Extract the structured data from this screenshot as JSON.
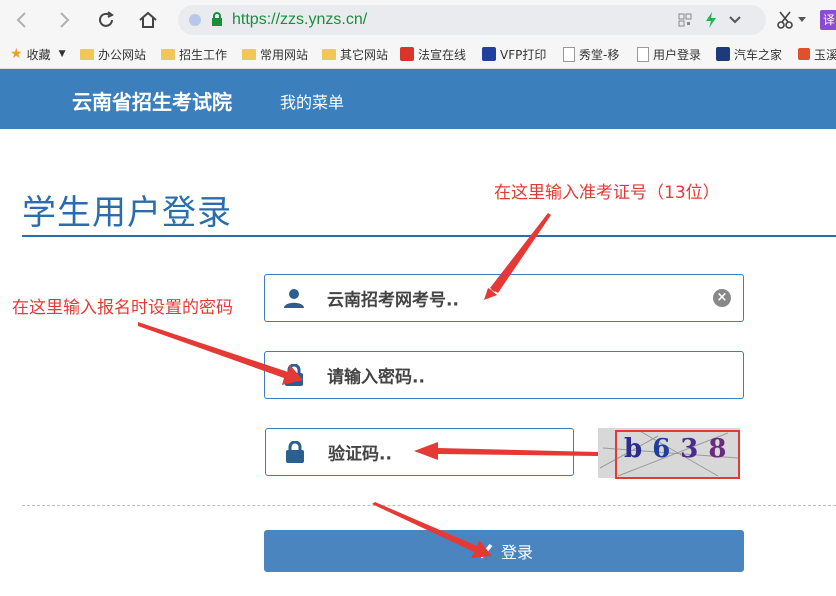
{
  "browser": {
    "url": "https://zzs.ynzs.cn/",
    "bookmarks": [
      {
        "label": "收藏",
        "icon": "star-icon"
      },
      {
        "label": "办公网站",
        "icon": "folder-icon"
      },
      {
        "label": "招生工作",
        "icon": "folder-icon"
      },
      {
        "label": "常用网站",
        "icon": "folder-icon"
      },
      {
        "label": "其它网站",
        "icon": "folder-icon"
      },
      {
        "label": "法宣在线",
        "icon": "site-icon"
      },
      {
        "label": "VFP打印",
        "icon": "paw-icon"
      },
      {
        "label": "秀堂-移",
        "icon": "page-icon"
      },
      {
        "label": "用户登录",
        "icon": "page-icon"
      },
      {
        "label": "汽车之家",
        "icon": "site-icon"
      },
      {
        "label": "玉溪",
        "icon": "site-icon"
      }
    ],
    "translate_label": "译"
  },
  "header": {
    "title": "云南省招生考试院",
    "menu": "我的菜单"
  },
  "login": {
    "page_title": "学生用户登录",
    "username_placeholder": "云南招考网考号..",
    "password_placeholder": "请输入密码..",
    "captcha_placeholder": "验证码..",
    "captcha_chars": [
      "b",
      "6",
      "3",
      "8"
    ],
    "submit_label": "登录"
  },
  "annotations": {
    "username_hint": "在这里输入准考证号（13位）",
    "password_hint": "在这里输入报名时设置的密码"
  },
  "colors": {
    "header_bg": "#3c7fbd",
    "accent": "#2a6dad",
    "annotation": "#e53935",
    "url_green": "#1a8f3a"
  }
}
